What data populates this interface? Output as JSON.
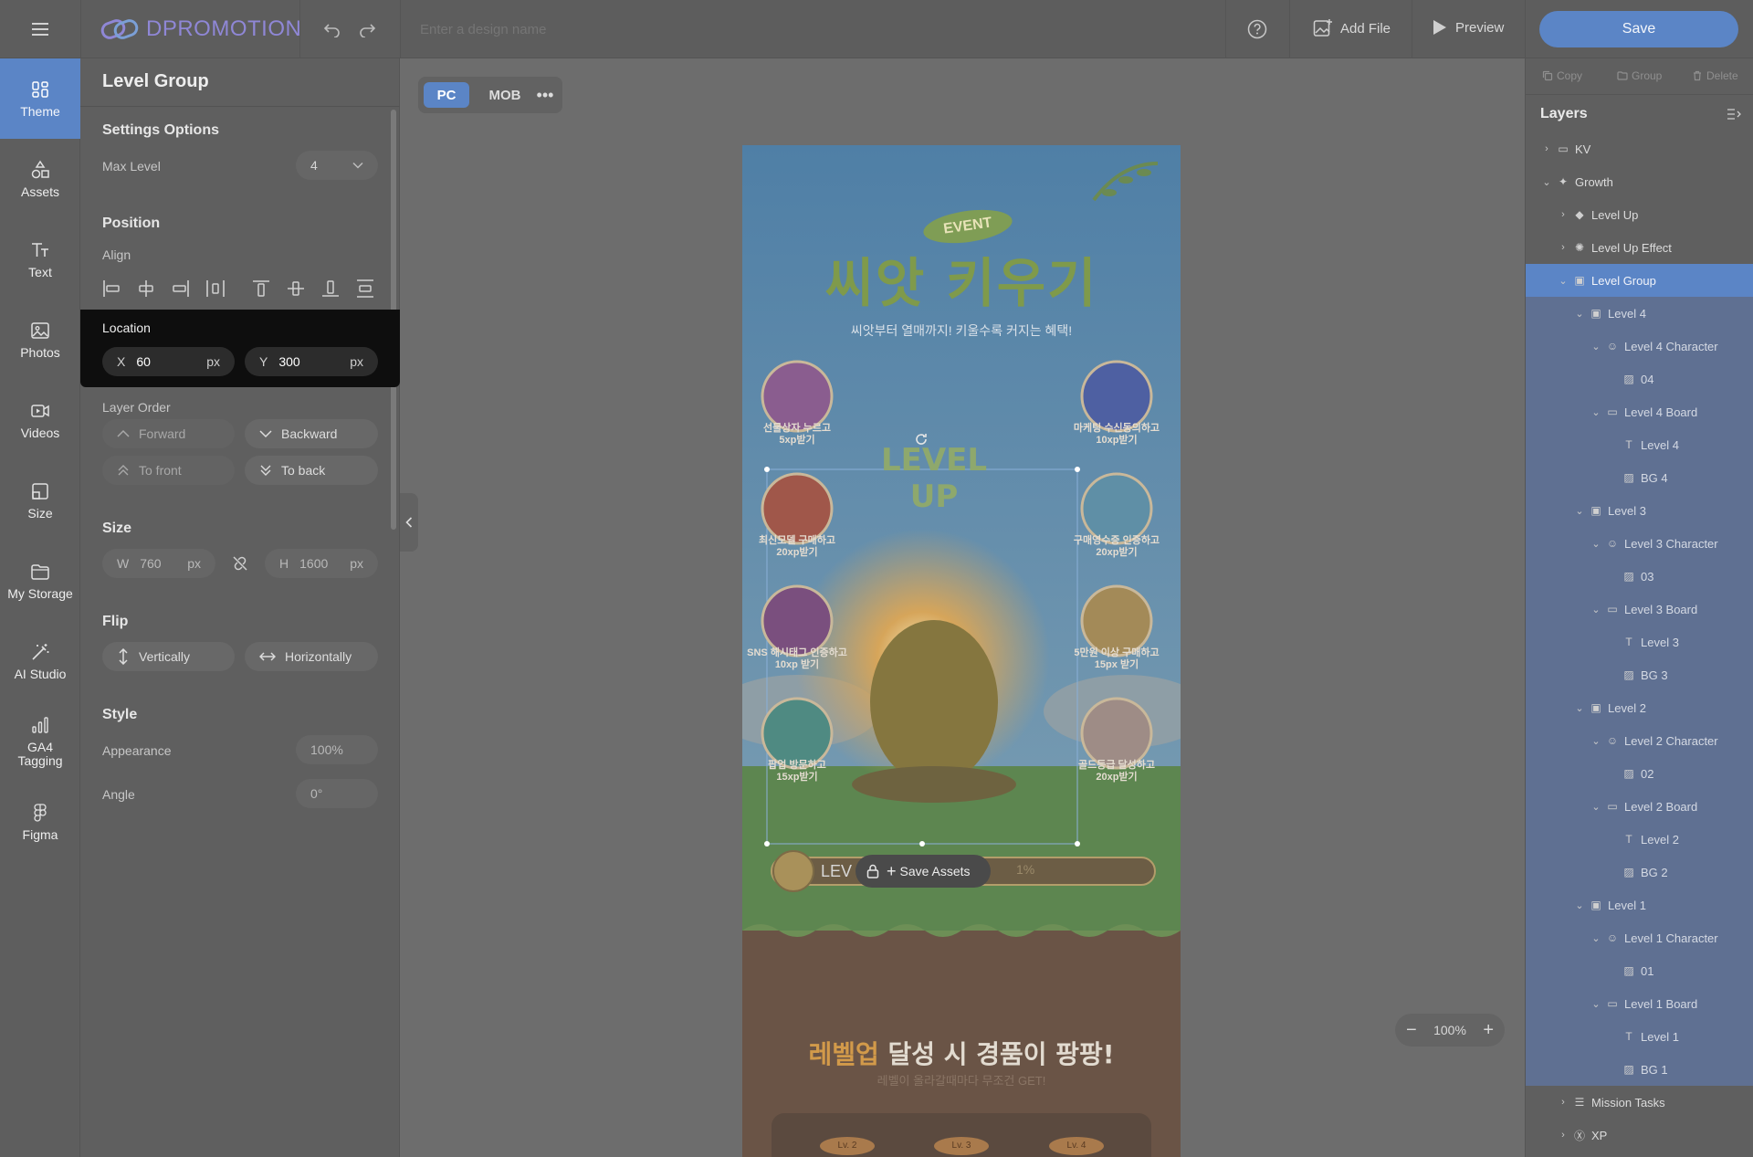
{
  "topbar": {
    "brand": "DPROMOTION",
    "design_name_placeholder": "Enter a design name",
    "add_file": "Add File",
    "preview": "Preview",
    "save": "Save",
    "help_icon": "question-circle-icon"
  },
  "rail": {
    "items": [
      {
        "label": "Theme",
        "icon": "theme-icon",
        "active": true
      },
      {
        "label": "Assets",
        "icon": "shapes-icon"
      },
      {
        "label": "Text",
        "icon": "text-icon"
      },
      {
        "label": "Photos",
        "icon": "image-icon"
      },
      {
        "label": "Videos",
        "icon": "video-icon"
      },
      {
        "label": "Size",
        "icon": "resize-icon"
      },
      {
        "label": "My Storage",
        "icon": "folder-icon"
      },
      {
        "label": "AI Studio",
        "icon": "magic-wand-icon"
      },
      {
        "label": "GA4\nTagging",
        "icon": "bar-chart-icon"
      },
      {
        "label": "Figma",
        "icon": "figma-icon"
      }
    ]
  },
  "left_panel": {
    "title": "Level Group",
    "settings_options": "Settings Options",
    "max_level_label": "Max Level",
    "max_level_value": "4",
    "position": "Position",
    "align": "Align",
    "location": "Location",
    "x_label": "X",
    "x_value": "60",
    "x_unit": "px",
    "y_label": "Y",
    "y_value": "300",
    "y_unit": "px",
    "layer_order": "Layer Order",
    "forward": "Forward",
    "backward": "Backward",
    "to_front": "To front",
    "to_back": "To back",
    "size": "Size",
    "w_label": "W",
    "w_value": "760",
    "w_unit": "px",
    "h_label": "H",
    "h_value": "1600",
    "h_unit": "px",
    "flip": "Flip",
    "vertically": "Vertically",
    "horizontally": "Horizontally",
    "style": "Style",
    "appearance": "Appearance",
    "appearance_value": "100%",
    "angle": "Angle",
    "angle_value": "0°"
  },
  "canvas": {
    "tab_pc": "PC",
    "tab_mob": "MOB",
    "event_badge": "EVENT",
    "headline": "씨앗 키우기",
    "subtitle": "씨앗부터 열매까지! 키울수록 커지는 혜택!",
    "level_up": "LEVEL UP",
    "missions_left": [
      "선물상자 누르고\n5xp받기",
      "최신모델 구매하고\n20xp받기",
      "SNS 해시태그 인증하고\n10xp 받기",
      "팝업 방문하고\n15xp받기"
    ],
    "missions_right": [
      "마케팅 수신동의하고\n10xp받기",
      "구매영수증 인증하고\n20xp받기",
      "5만원 이상 구매하고\n15px 받기",
      "골드등급 달성하고\n20xp받기"
    ],
    "level_bar_text": "LEV",
    "level_percent": "1%",
    "save_assets": "Save Assets",
    "bottom_title_highlight": "레벨업",
    "bottom_title_rest": " 달성 시 경품이 팡팡!",
    "bottom_subtitle": "레벨이 올라갈때마다 무조건 GET!",
    "lv_tags": [
      "Lv. 2",
      "Lv. 3",
      "Lv. 4"
    ],
    "zoom": "100%"
  },
  "right_panel": {
    "copy": "Copy",
    "group": "Group",
    "delete": "Delete",
    "layers_title": "Layers",
    "layers": [
      {
        "label": "KV",
        "depth": 0,
        "chev": "›",
        "icon": "folder-icon",
        "state": ""
      },
      {
        "label": "Growth",
        "depth": 0,
        "chev": "⌄",
        "icon": "sparkle-icon",
        "state": ""
      },
      {
        "label": "Level Up",
        "depth": 1,
        "chev": "›",
        "icon": "diamond-icon",
        "state": ""
      },
      {
        "label": "Level Up Effect",
        "depth": 1,
        "chev": "›",
        "icon": "effect-icon",
        "state": ""
      },
      {
        "label": "Level Group",
        "depth": 1,
        "chev": "⌄",
        "icon": "group-icon",
        "state": "sel"
      },
      {
        "label": "Level 4",
        "depth": 2,
        "chev": "⌄",
        "icon": "group-icon",
        "state": "sub"
      },
      {
        "label": "Level 4 Character",
        "depth": 3,
        "chev": "⌄",
        "icon": "character-icon",
        "state": "sub"
      },
      {
        "label": "04",
        "depth": 4,
        "chev": "",
        "icon": "image-icon",
        "state": "sub"
      },
      {
        "label": "Level 4 Board",
        "depth": 3,
        "chev": "⌄",
        "icon": "board-icon",
        "state": "sub"
      },
      {
        "label": "Level 4",
        "depth": 4,
        "chev": "",
        "icon": "text-icon",
        "state": "sub"
      },
      {
        "label": "BG 4",
        "depth": 4,
        "chev": "",
        "icon": "image-icon",
        "state": "sub"
      },
      {
        "label": "Level 3",
        "depth": 2,
        "chev": "⌄",
        "icon": "group-icon",
        "state": "sub"
      },
      {
        "label": "Level 3 Character",
        "depth": 3,
        "chev": "⌄",
        "icon": "character-icon",
        "state": "sub"
      },
      {
        "label": "03",
        "depth": 4,
        "chev": "",
        "icon": "image-icon",
        "state": "sub"
      },
      {
        "label": "Level 3 Board",
        "depth": 3,
        "chev": "⌄",
        "icon": "board-icon",
        "state": "sub"
      },
      {
        "label": "Level 3",
        "depth": 4,
        "chev": "",
        "icon": "text-icon",
        "state": "sub"
      },
      {
        "label": "BG 3",
        "depth": 4,
        "chev": "",
        "icon": "image-icon",
        "state": "sub"
      },
      {
        "label": "Level 2",
        "depth": 2,
        "chev": "⌄",
        "icon": "group-icon",
        "state": "sub"
      },
      {
        "label": "Level 2 Character",
        "depth": 3,
        "chev": "⌄",
        "icon": "character-icon",
        "state": "sub"
      },
      {
        "label": "02",
        "depth": 4,
        "chev": "",
        "icon": "image-icon",
        "state": "sub"
      },
      {
        "label": "Level 2 Board",
        "depth": 3,
        "chev": "⌄",
        "icon": "board-icon",
        "state": "sub"
      },
      {
        "label": "Level 2",
        "depth": 4,
        "chev": "",
        "icon": "text-icon",
        "state": "sub"
      },
      {
        "label": "BG 2",
        "depth": 4,
        "chev": "",
        "icon": "image-icon",
        "state": "sub"
      },
      {
        "label": "Level 1",
        "depth": 2,
        "chev": "⌄",
        "icon": "group-icon",
        "state": "sub"
      },
      {
        "label": "Level 1 Character",
        "depth": 3,
        "chev": "⌄",
        "icon": "character-icon",
        "state": "sub"
      },
      {
        "label": "01",
        "depth": 4,
        "chev": "",
        "icon": "image-icon",
        "state": "sub"
      },
      {
        "label": "Level 1 Board",
        "depth": 3,
        "chev": "⌄",
        "icon": "board-icon",
        "state": "sub"
      },
      {
        "label": "Level 1",
        "depth": 4,
        "chev": "",
        "icon": "text-icon",
        "state": "sub"
      },
      {
        "label": "BG 1",
        "depth": 4,
        "chev": "",
        "icon": "image-icon",
        "state": "sub"
      },
      {
        "label": "Mission Tasks",
        "depth": 1,
        "chev": "›",
        "icon": "list-icon",
        "state": ""
      },
      {
        "label": "XP",
        "depth": 1,
        "chev": "›",
        "icon": "xp-icon",
        "state": ""
      }
    ]
  },
  "colors": {
    "accent": "#5b85c6",
    "brand": "#8f87d6",
    "overlay": "#6b6b6b",
    "location_bg": "#0e0e0e"
  }
}
